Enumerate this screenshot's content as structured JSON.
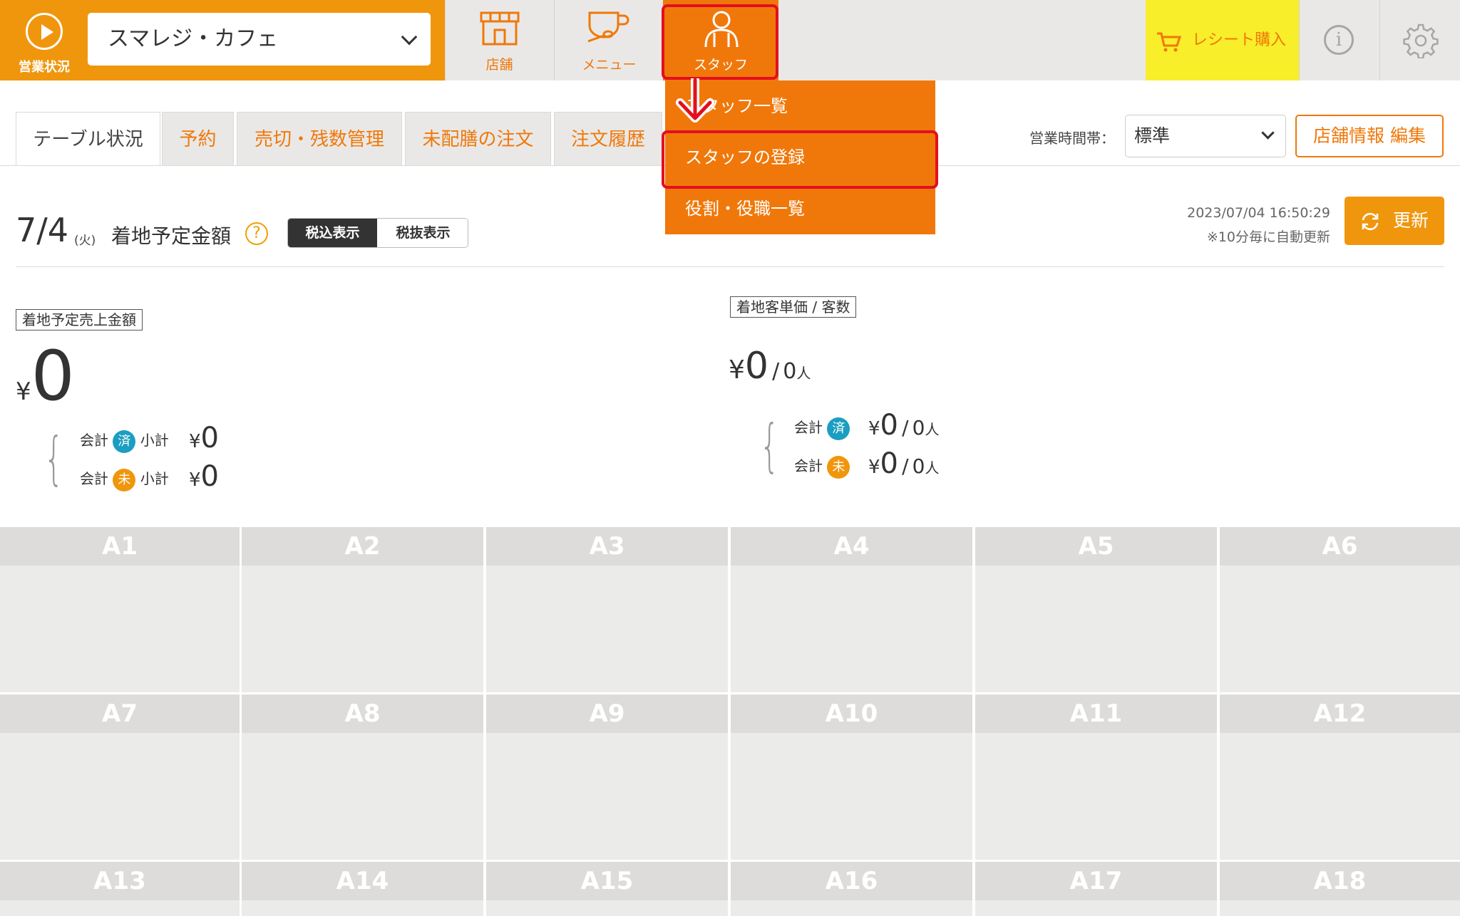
{
  "header": {
    "status_label": "営業状況",
    "store_name": "スマレジ・カフェ",
    "nav": {
      "store_label": "店舗",
      "menu_label": "メニュー",
      "staff_label": "スタッフ"
    },
    "receipt_label": "レシート購入",
    "info_glyph": "i"
  },
  "dropdown": {
    "items": [
      "スタッフ一覧",
      "スタッフの登録",
      "役割・役職一覧"
    ]
  },
  "tabs": [
    "テーブル状況",
    "予約",
    "売切・残数管理",
    "未配膳の注文",
    "注文履歴"
  ],
  "toolbar": {
    "hours_label": "営業時間帯：",
    "hours_value": "標準",
    "store_edit_label": "店舗情報 編集"
  },
  "summary": {
    "date": "7/4",
    "weekday": "(火)",
    "title": "着地予定金額",
    "help": "?",
    "tax_in": "税込表示",
    "tax_out": "税抜表示",
    "updated_at": "2023/07/04 16:50:29",
    "auto_note": "※10分毎に自動更新",
    "refresh_label": "更新",
    "yen": "¥",
    "sales_label": "着地予定売上金額",
    "sales_total": "0",
    "account_label": "会計",
    "subtotal_label": "小計",
    "done_badge": "済",
    "pending_badge": "未",
    "paid_subtotal": "0",
    "unpaid_subtotal": "0",
    "unit_label": "着地客単価 / 客数",
    "unit_price": "0",
    "slash": "/",
    "customers": "0",
    "people_unit": "人",
    "paid_unit_price": "0",
    "paid_customers": "0",
    "unpaid_unit_price": "0",
    "unpaid_customers": "0"
  },
  "tables": [
    "A1",
    "A2",
    "A3",
    "A4",
    "A5",
    "A6",
    "A7",
    "A8",
    "A9",
    "A10",
    "A11",
    "A12",
    "A13",
    "A14",
    "A15",
    "A16",
    "A17",
    "A18"
  ],
  "colors": {
    "accent": "#f0780a",
    "brand": "#f0960d",
    "highlight": "#e30f1f",
    "receipt_bg": "#f8ee2a",
    "done": "#1b9ec1"
  }
}
